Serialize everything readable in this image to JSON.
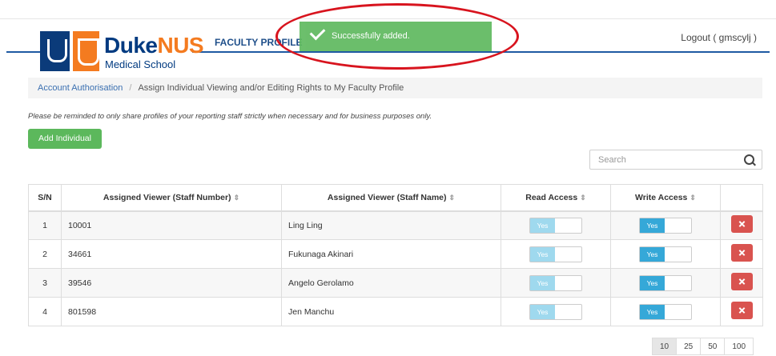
{
  "header": {
    "brand_main": "Duke",
    "brand_accent": "NUS",
    "brand_sub": "Medical School",
    "nav_faculty": "FACULTY PROFILE",
    "logout": "Logout ( gmscylj )"
  },
  "toast": {
    "message": "Successfully added."
  },
  "breadcrumb": {
    "link": "Account Authorisation",
    "separator": "/",
    "current": "Assign Individual Viewing and/or Editing Rights to My Faculty Profile"
  },
  "reminder": "Please be reminded to only share profiles of your reporting staff strictly when necessary and for business purposes only.",
  "add_button": "Add Individual",
  "search": {
    "placeholder": "Search"
  },
  "table": {
    "headers": {
      "sn": "S/N",
      "staff_number": "Assigned Viewer (Staff Number)",
      "staff_name": "Assigned Viewer (Staff Name)",
      "read": "Read Access",
      "write": "Write Access"
    },
    "sort_glyph": "⇕",
    "toggle_on": "Yes",
    "rows": [
      {
        "sn": "1",
        "number": "10001",
        "name": "Ling Ling"
      },
      {
        "sn": "2",
        "number": "34661",
        "name": "Fukunaga Akinari"
      },
      {
        "sn": "3",
        "number": "39546",
        "name": "Angelo Gerolamo"
      },
      {
        "sn": "4",
        "number": "801598",
        "name": "Jen Manchu"
      }
    ]
  },
  "pager": [
    "10",
    "25",
    "50",
    "100"
  ],
  "colors": {
    "brand_blue": "#003a80",
    "brand_orange": "#f47b20",
    "success": "#5cb85c",
    "danger": "#d9534f",
    "toggle_on": "#35a8d8"
  },
  "icons": [
    "shield-icon",
    "crest-icon",
    "check-icon",
    "search-icon",
    "sort-icon",
    "close-icon"
  ]
}
